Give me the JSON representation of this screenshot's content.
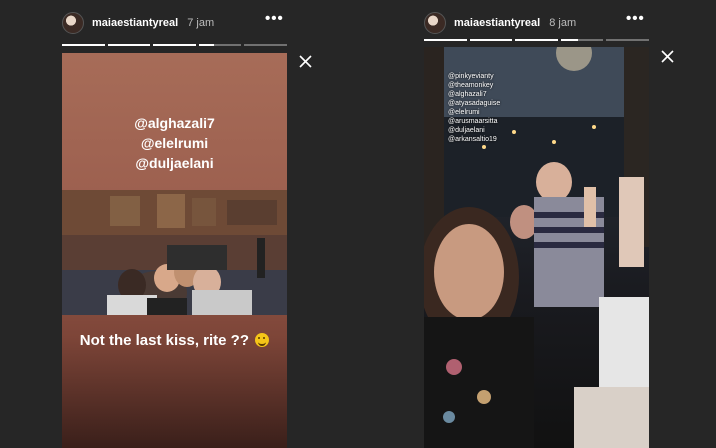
{
  "stories": [
    {
      "username": "maiaestiantyreal",
      "time": "7 jam",
      "progress": [
        1,
        1,
        1,
        0.35,
        0
      ],
      "mentions": [
        "@alghazali7",
        "@elelrumi",
        "@duljaelani"
      ],
      "caption": "Not the last kiss, rite ??",
      "caption_emoji": "grinning-face-emoji",
      "background": "#a76c58"
    },
    {
      "username": "maiaestiantyreal",
      "time": "8 jam",
      "progress": [
        1,
        1,
        1,
        0.4,
        0
      ],
      "tags": [
        "@pinkyevianty",
        "@theamonkey",
        "@alghazali7",
        "@atyasadaguise",
        "@elelrumi",
        "@arusmaarsitta",
        "@duljaelani",
        "@arkansaltio19"
      ]
    }
  ],
  "icons": {
    "more": "more-options-icon",
    "close": "close-icon"
  }
}
